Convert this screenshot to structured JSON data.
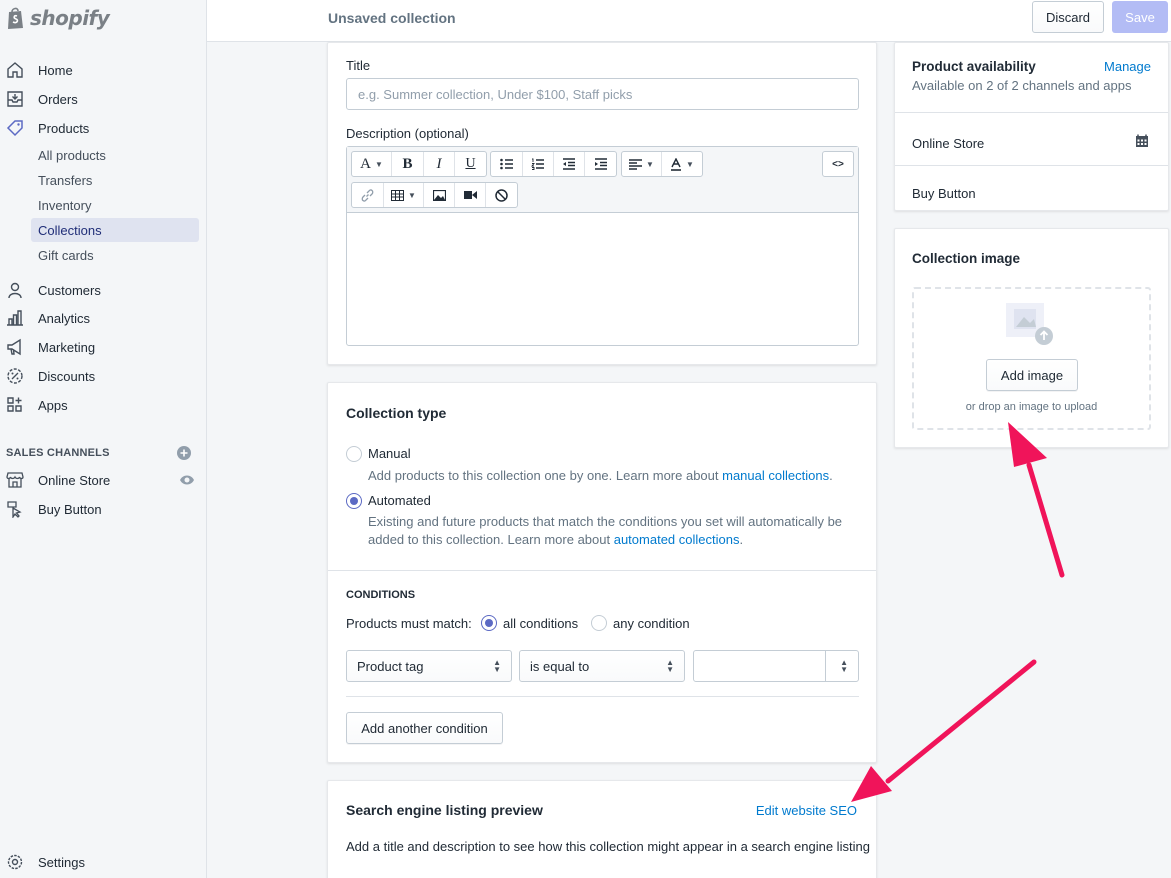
{
  "brand": {
    "name": "shopify"
  },
  "sidebar": {
    "main": [
      {
        "label": "Home",
        "icon": "home-icon"
      },
      {
        "label": "Orders",
        "icon": "orders-icon"
      },
      {
        "label": "Products",
        "icon": "products-tag-icon"
      }
    ],
    "products_sub": [
      {
        "label": "All products",
        "active": false
      },
      {
        "label": "Transfers",
        "active": false
      },
      {
        "label": "Inventory",
        "active": false
      },
      {
        "label": "Collections",
        "active": true
      },
      {
        "label": "Gift cards",
        "active": false
      }
    ],
    "more": [
      {
        "label": "Customers",
        "icon": "customers-icon"
      },
      {
        "label": "Analytics",
        "icon": "analytics-icon"
      },
      {
        "label": "Marketing",
        "icon": "marketing-icon"
      },
      {
        "label": "Discounts",
        "icon": "discounts-icon"
      },
      {
        "label": "Apps",
        "icon": "apps-icon"
      }
    ],
    "sales_channels_heading": "SALES CHANNELS",
    "channels": [
      {
        "label": "Online Store",
        "icon": "online-store-icon"
      },
      {
        "label": "Buy Button",
        "icon": "buy-button-icon"
      }
    ],
    "settings": "Settings"
  },
  "topbar": {
    "title": "Unsaved collection",
    "discard": "Discard",
    "save": "Save"
  },
  "details": {
    "title_label": "Title",
    "title_placeholder": "e.g. Summer collection, Under $100, Staff picks",
    "description_label": "Description (optional)",
    "toolbar": {
      "font": "A",
      "bold": "B",
      "italic": "I",
      "underline": "U",
      "code": "<>"
    }
  },
  "collection_type": {
    "heading": "Collection type",
    "manual_label": "Manual",
    "manual_help": "Add products to this collection one by one. Learn more about ",
    "manual_link": "manual collections",
    "automated_label": "Automated",
    "automated_help_1": "Existing and future products that match the conditions you set will automatically be",
    "automated_help_2": "added to this collection. Learn more about ",
    "automated_link": "automated collections",
    "selected": "Automated"
  },
  "conditions": {
    "heading": "CONDITIONS",
    "match_label": "Products must match:",
    "all_label": "all conditions",
    "any_label": "any condition",
    "selected": "all conditions",
    "field": "Product tag",
    "operator": "is equal to",
    "value": "",
    "add_button": "Add another condition"
  },
  "seo": {
    "heading": "Search engine listing preview",
    "edit_link": "Edit website SEO",
    "description": "Add a title and description to see how this collection might appear in a search engine listing"
  },
  "availability": {
    "heading": "Product availability",
    "manage": "Manage",
    "summary": "Available on 2 of 2 channels and apps",
    "channels": [
      "Online Store",
      "Buy Button"
    ]
  },
  "collection_image": {
    "heading": "Collection image",
    "add_button": "Add image",
    "hint": "or drop an image to upload"
  },
  "annotation_color": "#f0145a"
}
